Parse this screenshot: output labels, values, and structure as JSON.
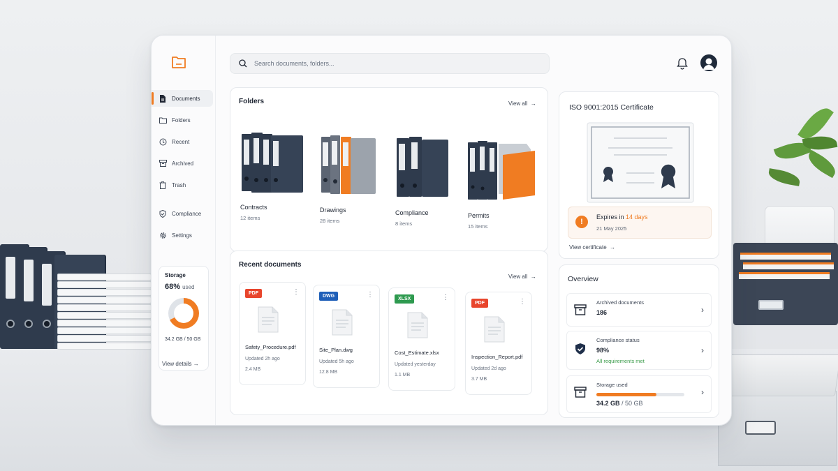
{
  "search": {
    "placeholder": "Search documents, folders..."
  },
  "sidebar": {
    "items": [
      {
        "label": "Documents",
        "icon": "document-icon",
        "active": true
      },
      {
        "label": "Folders",
        "icon": "folder-icon"
      },
      {
        "label": "Recent",
        "icon": "clock-icon"
      },
      {
        "label": "Archived",
        "icon": "archive-icon"
      },
      {
        "label": "Trash",
        "icon": "trash-icon"
      },
      {
        "label": "Compliance",
        "icon": "shield-icon"
      },
      {
        "label": "Settings",
        "icon": "gear-icon"
      }
    ],
    "storage": {
      "title": "Storage",
      "percent": "68%",
      "percent_suffix": "used",
      "used_text": "34.2 GB / 50 GB",
      "fraction": 0.68
    },
    "view_details": "View details"
  },
  "folders": {
    "title": "Folders",
    "view_all": "View all",
    "items": [
      {
        "name": "Contracts",
        "count": "12 items"
      },
      {
        "name": "Drawings",
        "count": "28 items"
      },
      {
        "name": "Compliance",
        "count": "8 items"
      },
      {
        "name": "Permits",
        "count": "15 items"
      }
    ]
  },
  "recent": {
    "title": "Recent documents",
    "view_all": "View all",
    "items": [
      {
        "type": "PDF",
        "color": "#e8452c",
        "name": "Safety_Procedure.pdf",
        "updated": "Updated 2h ago",
        "size": "2.4 MB"
      },
      {
        "type": "DWG",
        "color": "#1f5fb8",
        "name": "Site_Plan.dwg",
        "updated": "Updated 5h ago",
        "size": "12.8 MB"
      },
      {
        "type": "XLSX",
        "color": "#2e9a4f",
        "name": "Cost_Estimate.xlsx",
        "updated": "Updated yesterday",
        "size": "1.1 MB"
      },
      {
        "type": "PDF",
        "color": "#e8452c",
        "name": "Inspection_Report.pdf",
        "updated": "Updated 2d ago",
        "size": "3.7 MB"
      }
    ]
  },
  "certificate": {
    "title": "ISO 9001:2015 Certificate",
    "expires_prefix": "Expires in",
    "expires_days": "14 days",
    "date": "21 May 2025",
    "view": "View certificate"
  },
  "overview": {
    "title": "Overview",
    "archived": {
      "label": "Archived documents",
      "value": "186"
    },
    "compliance": {
      "label": "Compliance status",
      "value": "98%",
      "sub": "All requirements met"
    },
    "storage": {
      "label": "Storage used",
      "value": "34.2 GB",
      "total": "/ 50 GB",
      "fraction": 0.68
    }
  },
  "colors": {
    "accent": "#f07c22",
    "navy": "#2f3b4d",
    "success": "#3a9b4a"
  }
}
